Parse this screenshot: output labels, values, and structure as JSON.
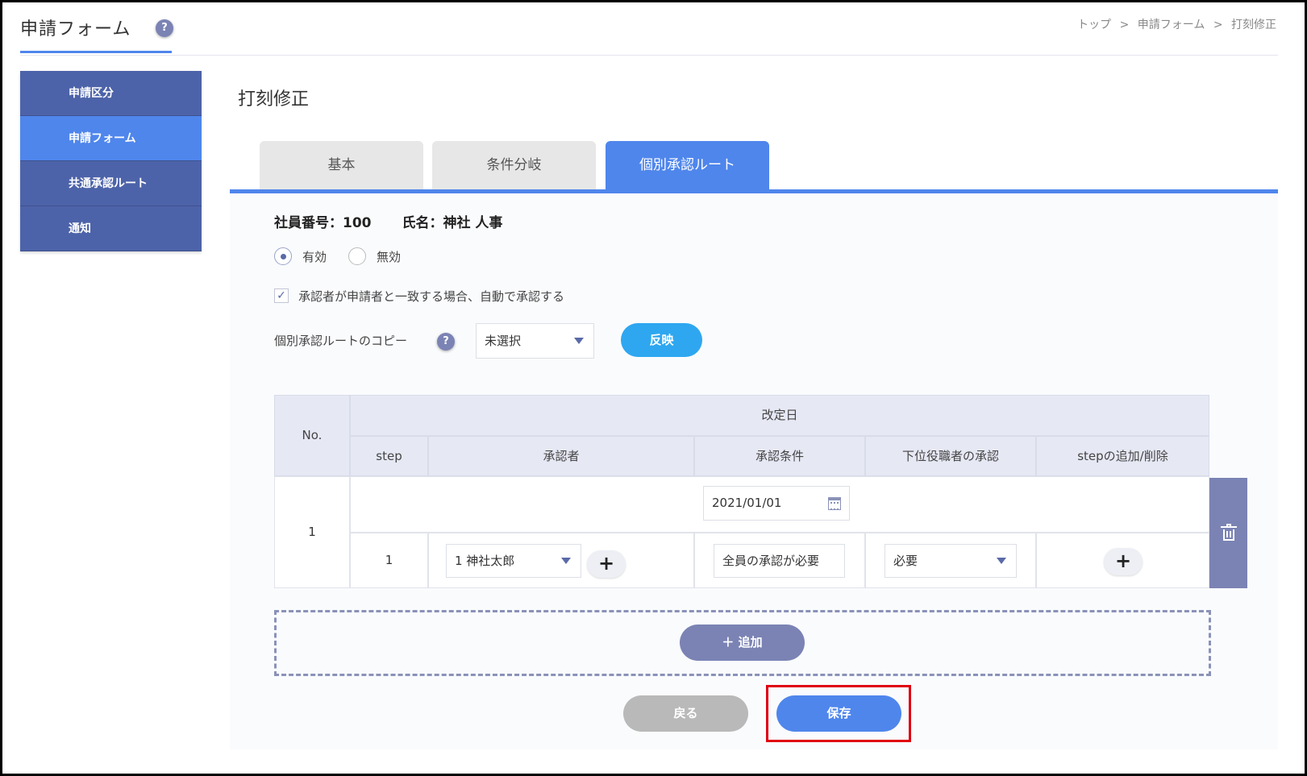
{
  "header": {
    "title": "申請フォーム",
    "help": "?",
    "breadcrumb": [
      "トップ",
      "申請フォーム",
      "打刻修正"
    ],
    "breadcrumb_sep": ">"
  },
  "sidebar": {
    "items": [
      {
        "label": "申請区分",
        "active": false
      },
      {
        "label": "申請フォーム",
        "active": true
      },
      {
        "label": "共通承認ルート",
        "active": false
      },
      {
        "label": "通知",
        "active": false
      }
    ]
  },
  "main": {
    "title": "打刻修正",
    "tabs": [
      {
        "label": "基本",
        "active": false
      },
      {
        "label": "条件分岐",
        "active": false
      },
      {
        "label": "個別承認ルート",
        "active": true
      }
    ],
    "employee_no": "社員番号：100",
    "employee_name": "氏名：神社 人事",
    "radio_valid": "有効",
    "radio_invalid": "無効",
    "auto_approve_label": "承認者が申請者と一致する場合、自動で承認する",
    "copy_label": "個別承認ルートのコピー",
    "copy_help": "?",
    "copy_select": "未選択",
    "reflect_button": "反映"
  },
  "table": {
    "headers": {
      "no": "No.",
      "revision_date": "改定日",
      "step": "step",
      "approver": "承認者",
      "condition": "承認条件",
      "subordinate": "下位役職者の承認",
      "add_remove": "stepの追加/削除"
    },
    "rows": [
      {
        "no": "1",
        "date": "2021/01/01",
        "steps": [
          {
            "step": "1",
            "approver": "1 神社太郎",
            "condition": "全員の承認が必要",
            "subordinate": "必要"
          }
        ]
      }
    ],
    "plus": "+"
  },
  "actions": {
    "add": "＋ 追加",
    "back": "戻る",
    "save": "保存"
  }
}
